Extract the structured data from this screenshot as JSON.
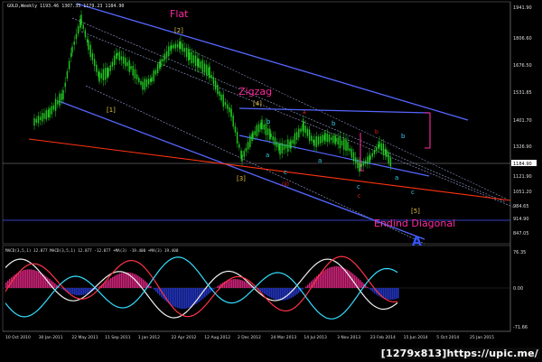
{
  "window": {
    "title_bar": "GOLD,Weekly  1193.46 1307.35 1179.23 1184.90",
    "badge": "[1279x813]https://upic.me/"
  },
  "price_axis": {
    "ticks": [
      "1941.90",
      "1806.60",
      "1676.50",
      "1531.85",
      "1401.70",
      "1326.90",
      "1184.90",
      "1121.90",
      "1051.20",
      "984.65",
      "914.90",
      "847.05"
    ],
    "current_price": "1184.90"
  },
  "time_axis": {
    "ticks": [
      "10 Oct 2010",
      "30 Jan 2011",
      "22 May 2011",
      "11 Sep 2011",
      "1 Jan 2012",
      "22 Apr 2012",
      "12 Aug 2012",
      "2 Dec 2012",
      "24 Mar 2013",
      "14 Jul 2013",
      "3 Nov 2013",
      "23 Feb 2014",
      "15 Jun 2014",
      "5 Oct 2014",
      "25 Jan 2015"
    ]
  },
  "annotations": {
    "flat": "Flat",
    "zigzag": "Zigzag",
    "ending_diagonal": "Endind Diagonal",
    "wave_2": "[2]",
    "wave_4": "[4]",
    "wave_1": "[1]",
    "wave_3": "[3]",
    "wave_5": "[5]",
    "big_a": "A",
    "a_label": "a",
    "b_label": "b",
    "c_label": "c",
    "red_a": "a",
    "red_b": "b",
    "red_c": "c",
    "red_ii": "(ii)"
  },
  "macd": {
    "label": "MACD(3,5,1) 12.877  MACD(3,5,1) 12.877 -12.877  +MA(3) -19.400  +MA(3) 19.400",
    "ticks": [
      "76.35",
      "0.00",
      "-71.66"
    ]
  },
  "colors": {
    "background": "#000000",
    "candle": "#22cc22",
    "channel_blue": "#5566ff",
    "trend_red": "#ff3311",
    "magenta": "#ff2aa0",
    "gold_label": "#e0c040",
    "cyan_label": "#33ccee",
    "red_label": "#ee2222"
  }
}
